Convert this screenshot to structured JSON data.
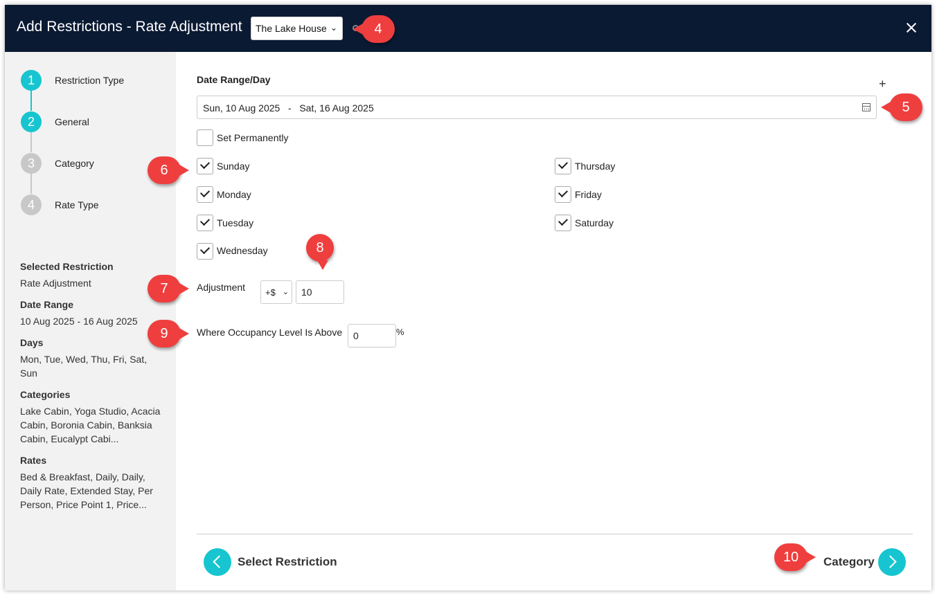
{
  "header": {
    "title": "Add Restrictions - Rate Adjustment",
    "property": "The Lake House",
    "property_chevron": "⌄"
  },
  "steps": [
    {
      "number": "1",
      "label": "Restriction Type",
      "state": "active"
    },
    {
      "number": "2",
      "label": "General",
      "state": "active"
    },
    {
      "number": "3",
      "label": "Category",
      "state": "inactive"
    },
    {
      "number": "4",
      "label": "Rate Type",
      "state": "inactive"
    }
  ],
  "summary": {
    "selected_restriction": {
      "heading": "Selected Restriction",
      "value": "Rate Adjustment"
    },
    "date_range": {
      "heading": "Date Range",
      "value": "10 Aug 2025 - 16 Aug 2025"
    },
    "days": {
      "heading": "Days",
      "value": "Mon, Tue, Wed, Thu, Fri, Sat, Sun"
    },
    "categories": {
      "heading": "Categories",
      "value": "Lake Cabin, Yoga Studio, Acacia Cabin, Boronia Cabin, Banksia Cabin, Eucalypt Cabi..."
    },
    "rates": {
      "heading": "Rates",
      "value": "Bed & Breakfast, Daily, Daily, Daily Rate, Extended Stay, Per Person, Price Point 1, Price..."
    }
  },
  "form": {
    "date_section_title": "Date Range/Day",
    "add_symbol": "+",
    "date_range_value": "Sun, 10 Aug 2025   -   Sat, 16 Aug 2025",
    "set_permanently": {
      "label": "Set Permanently",
      "checked": false
    },
    "days": {
      "sunday": {
        "label": "Sunday",
        "checked": true
      },
      "monday": {
        "label": "Monday",
        "checked": true
      },
      "tuesday": {
        "label": "Tuesday",
        "checked": true
      },
      "wednesday": {
        "label": "Wednesday",
        "checked": true
      },
      "thursday": {
        "label": "Thursday",
        "checked": true
      },
      "friday": {
        "label": "Friday",
        "checked": true
      },
      "saturday": {
        "label": "Saturday",
        "checked": true
      }
    },
    "adjustment": {
      "label": "Adjustment",
      "type": "+$",
      "chevron": "⌄",
      "value": "10"
    },
    "occupancy": {
      "label": "Where Occupancy Level Is Above",
      "value": "0",
      "unit": "%"
    }
  },
  "footer": {
    "back_label": "Select Restriction",
    "next_label": "Category"
  },
  "callouts": {
    "c4": "4",
    "c5": "5",
    "c6": "6",
    "c7": "7",
    "c8": "8",
    "c9": "9",
    "c10": "10"
  },
  "colors": {
    "header_bg": "#0b1a33",
    "accent": "#16c5cf",
    "callout": "#ef3e3e",
    "sidebar_bg": "#f2f2f2"
  }
}
